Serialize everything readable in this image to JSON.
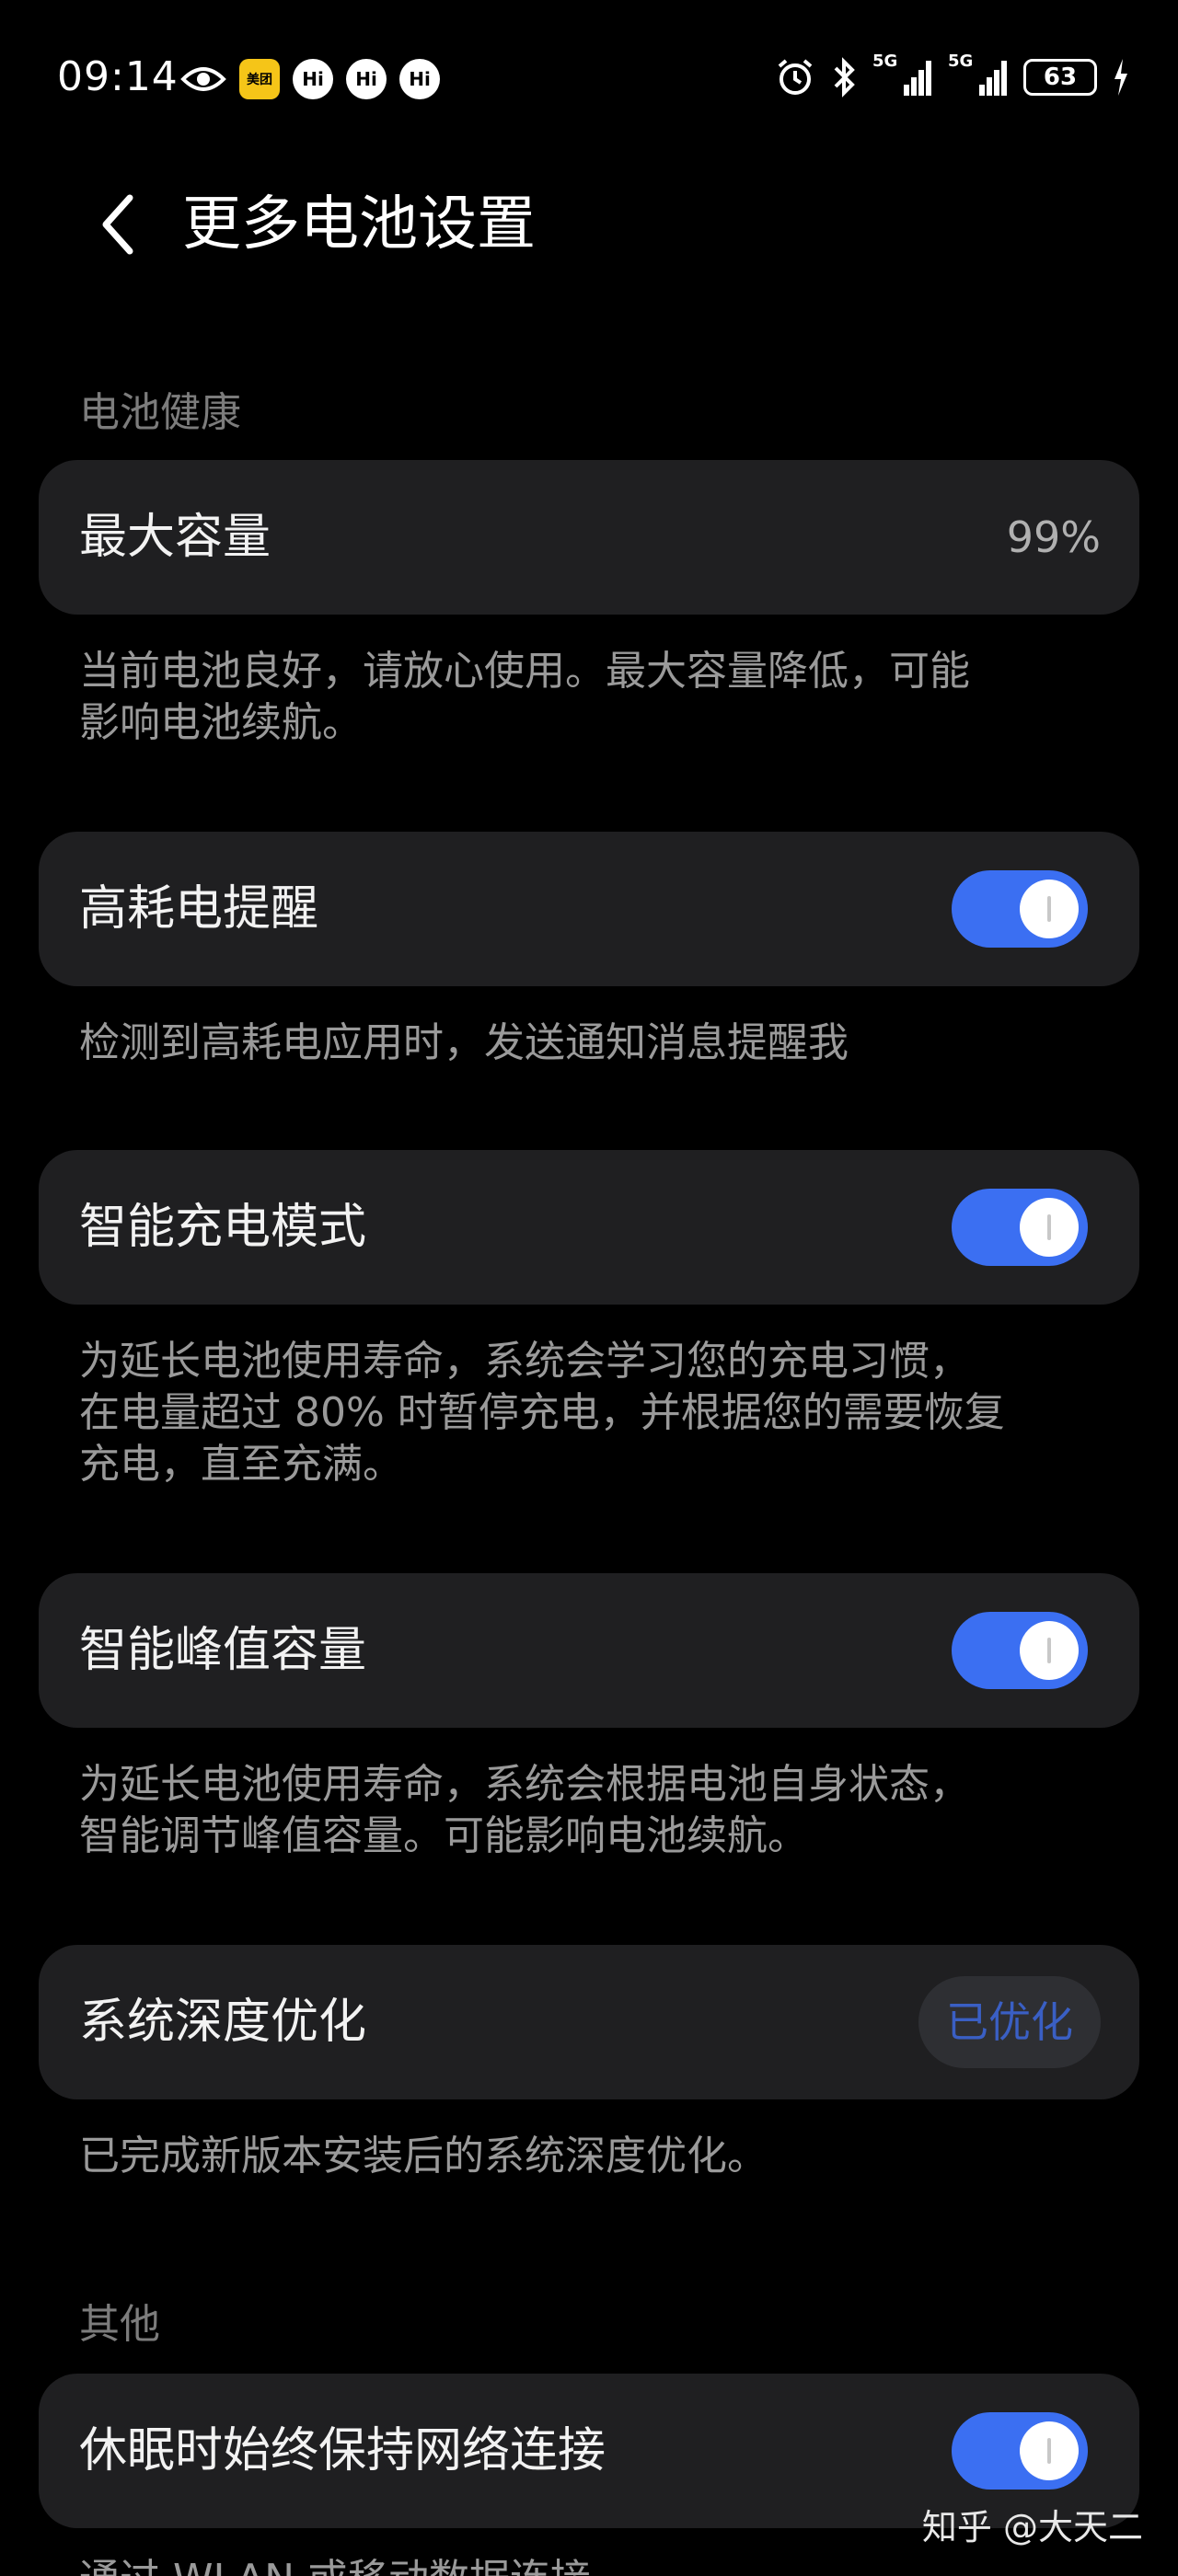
{
  "status_bar": {
    "time": "09:14",
    "meituan_label": "美团",
    "hi_label": "Hi",
    "net1_label": "5G",
    "net2_label": "5G",
    "battery": "63"
  },
  "header": {
    "title": "更多电池设置"
  },
  "sections": {
    "battery_health": "电池健康",
    "other": "其他"
  },
  "rows": {
    "max_capacity": {
      "label": "最大容量",
      "value": "99%",
      "desc1": "当前电池良好，请放心使用。最大容量降低，可能",
      "desc2": "影响电池续航。"
    },
    "high_drain": {
      "label": "高耗电提醒",
      "enabled": true,
      "desc1": "检测到高耗电应用时，发送通知消息提醒我"
    },
    "smart_charge": {
      "label": "智能充电模式",
      "enabled": true,
      "desc1": "为延长电池使用寿命，系统会学习您的充电习惯，",
      "desc2": "在电量超过 80% 时暂停充电，并根据您的需要恢复",
      "desc3": "充电，直至充满。"
    },
    "peak_capacity": {
      "label": "智能峰值容量",
      "enabled": true,
      "desc1": "为延长电池使用寿命，系统会根据电池自身状态，",
      "desc2": "智能调节峰值容量。可能影响电池续航。"
    },
    "deep_optimize": {
      "label": "系统深度优化",
      "button": "已优化",
      "desc1": "已完成新版本安装后的系统深度优化。"
    },
    "keep_network": {
      "label": "休眠时始终保持网络连接",
      "enabled": true,
      "desc1": "通过 WLAN 或移动数据连接..."
    }
  },
  "watermark": "知乎 @大天二",
  "colors": {
    "background": "#000000",
    "card": "#1f1f21",
    "toggle_on": "#3b6ff2",
    "section_label": "#7c7c7c",
    "description": "#9a9a9a"
  }
}
